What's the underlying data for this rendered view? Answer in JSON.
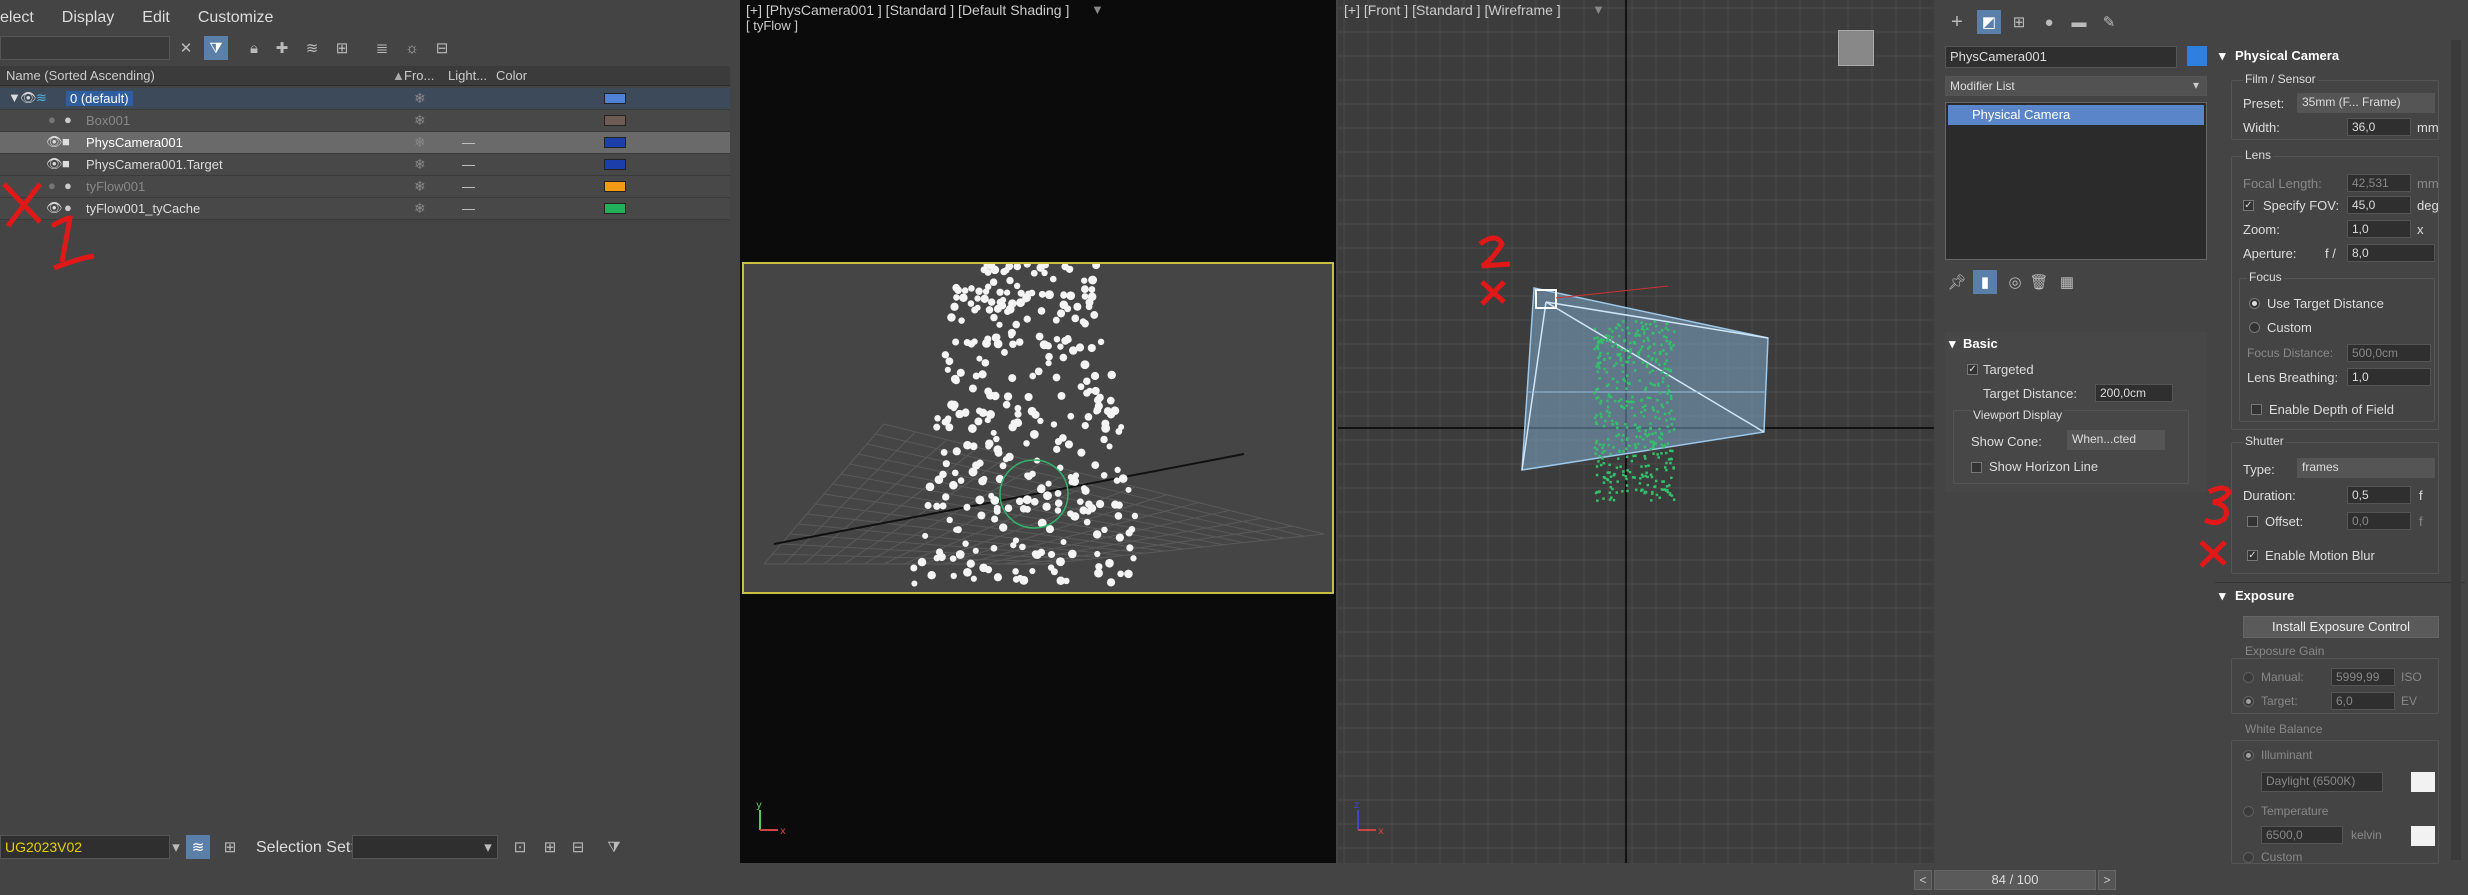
{
  "menu": {
    "items": [
      "elect",
      "Display",
      "Edit",
      "Customize"
    ]
  },
  "scene_explorer": {
    "columns": {
      "name": "Name (Sorted Ascending)",
      "frozen": "Fro...",
      "light": "Light...",
      "color": "Color"
    },
    "rows": [
      {
        "name": "0 (default)",
        "color": "#4f82d6"
      },
      {
        "name": "Box001",
        "color": "#6e5b53"
      },
      {
        "name": "PhysCamera001",
        "color": "#1c3ea8"
      },
      {
        "name": "PhysCamera001.Target",
        "color": "#1c3ea8"
      },
      {
        "name": "tyFlow001",
        "color": "#f29a16"
      },
      {
        "name": "tyFlow001_tyCache",
        "color": "#22b05a"
      }
    ],
    "layer_value": "UG2023V02",
    "selection_set_label": "Selection Set:"
  },
  "annotations": {
    "a1_num": "1",
    "a1_x": "x",
    "a2_num": "2",
    "a2_x": "x",
    "a3_num": "3",
    "a3_x": "x"
  },
  "viewport_camera": {
    "label": "[+] [PhysCamera001 ] [Standard ] [Default Shading ]",
    "sublabel": "[ tyFlow ]"
  },
  "viewport_front": {
    "label": "[+] [Front ] [Standard ] [Wireframe ]"
  },
  "command_panel": {
    "object_name": "PhysCamera001",
    "object_color": "#2f7fe0",
    "modifier_list": "Modifier List",
    "stack_item": "Physical Camera",
    "basic": {
      "title": "Basic",
      "targeted": "Targeted",
      "target_distance_label": "Target Distance:",
      "target_distance_value": "200,0cm",
      "viewport_display": "Viewport Display",
      "show_cone_label": "Show Cone:",
      "show_cone_value": "When...cted",
      "show_horizon": "Show Horizon Line"
    }
  },
  "physical_camera": {
    "title": "Physical Camera",
    "film_sensor": "Film / Sensor",
    "preset_label": "Preset:",
    "preset_value": "35mm (F... Frame)",
    "width_label": "Width:",
    "width_value": "36,0",
    "width_unit": "mm",
    "lens": "Lens",
    "focal_label": "Focal Length:",
    "focal_value": "42,531",
    "focal_unit": "mm",
    "fov_label": "Specify FOV:",
    "fov_value": "45,0",
    "fov_unit": "deg",
    "zoom_label": "Zoom:",
    "zoom_value": "1,0",
    "zoom_unit": "x",
    "aperture_label": "Aperture:",
    "aperture_f": "f /",
    "aperture_value": "8,0",
    "focus": "Focus",
    "use_target": "Use Target Distance",
    "custom": "Custom",
    "focus_distance_label": "Focus Distance:",
    "focus_distance_value": "500,0cm",
    "lens_breathing_label": "Lens Breathing:",
    "lens_breathing_value": "1,0",
    "dof": "Enable Depth of Field",
    "shutter": "Shutter",
    "type_label": "Type:",
    "type_value": "frames",
    "duration_label": "Duration:",
    "duration_value": "0,5",
    "duration_unit": "f",
    "offset_label": "Offset:",
    "offset_value": "0,0",
    "offset_unit": "f",
    "motion_blur": "Enable Motion Blur"
  },
  "exposure": {
    "title": "Exposure",
    "install_button": "Install Exposure Control",
    "gain": "Exposure Gain",
    "manual_label": "Manual:",
    "manual_value": "5999,99",
    "manual_unit": "ISO",
    "target_label": "Target:",
    "target_value": "6,0",
    "target_unit": "EV",
    "white_balance": "White Balance",
    "illuminant": "Illuminant",
    "illuminant_value": "Daylight (6500K)",
    "temperature": "Temperature",
    "temperature_value": "6500,0",
    "temperature_unit": "kelvin",
    "custom": "Custom"
  },
  "timeline": {
    "frame": "84 / 100"
  }
}
